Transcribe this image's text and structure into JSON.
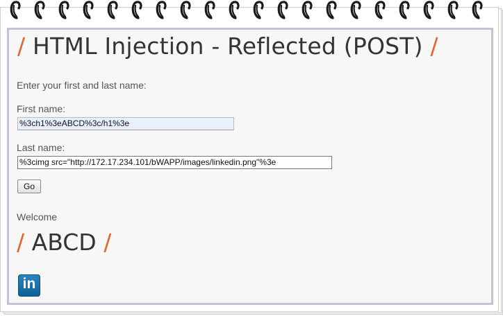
{
  "page": {
    "title_slash_left": "/",
    "title": "HTML Injection - Reflected (POST)",
    "title_slash_right": "/",
    "intro": "Enter your first and last name:",
    "first_name_label": "First name:",
    "first_name_value": "%3ch1%3eABCD%3c/h1%3e",
    "last_name_label": "Last name:",
    "last_name_value": "%3cimg src=\"http://172.17.234.101/bWAPP/images/linkedin.png\"%3e",
    "go_label": "Go",
    "welcome": "Welcome",
    "result_slash_left": "/",
    "result_text": "ABCD",
    "result_slash_right": "/",
    "injected_image_text": "in"
  },
  "colors": {
    "accent_slash": "#e3672b",
    "frame_border": "#c3c3dc",
    "linkedin_blue": "#0e76a8"
  }
}
